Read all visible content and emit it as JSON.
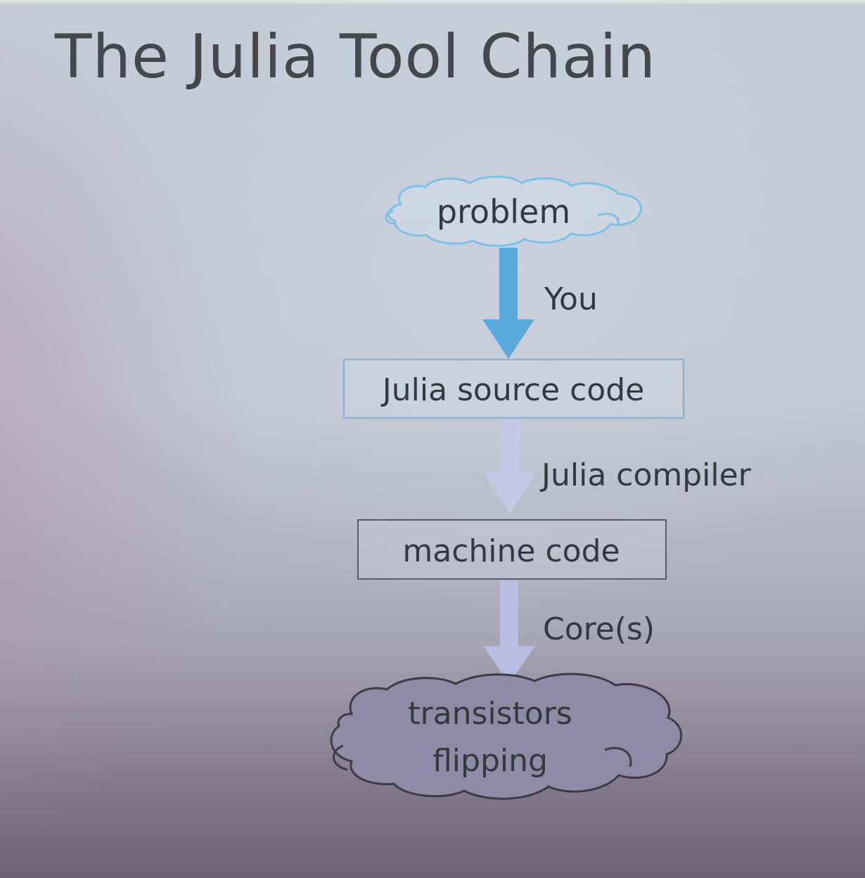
{
  "slide": {
    "title": "The Julia Tool Chain"
  },
  "diagram": {
    "nodes": {
      "problem": "problem",
      "source": "Julia source code",
      "machine": "machine code",
      "transistors_line1": "transistors",
      "transistors_line2": "flipping"
    },
    "edges": {
      "you": "You",
      "compiler": "Julia compiler",
      "cores": "Core(s)"
    },
    "colors": {
      "problem_outline": "#7ec1e6",
      "arrow_you": "#5aa9dc",
      "box_border_blue": "#8fb3cf",
      "arrow_compiler": "#c6c8e6",
      "box_border_gray": "#5a5c62",
      "arrow_cores": "#b9bce0",
      "transistor_fill": "#8f8aa5",
      "transistor_outline": "#3e3a48"
    }
  }
}
